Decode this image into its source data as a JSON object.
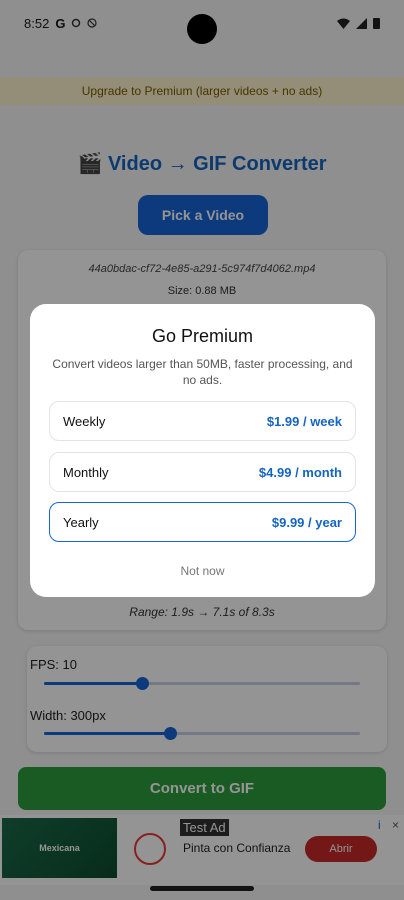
{
  "status": {
    "time": "8:52",
    "g": "G"
  },
  "banner": {
    "text": "Upgrade to Premium (larger videos + no ads)"
  },
  "title": "🎬 Video → GIF Converter",
  "pick_button": "Pick a Video",
  "file": {
    "name": "44a0bdac-cf72-4e85-a291-5c974f7d4062.mp4",
    "size": "Size: 0.88 MB",
    "range": "Range: 1.9s → 7.1s of 8.3s"
  },
  "settings": {
    "fps_label": "FPS: 10",
    "fps_fraction": 0.31,
    "width_label": "Width: 300px",
    "width_fraction": 0.4
  },
  "convert_button": "Convert to GIF",
  "ad": {
    "tag": "Test Ad",
    "title": "Pinta con Confianza",
    "cta": "Abrir",
    "image_text": "Mexicana",
    "info_icon": "i",
    "close_icon": "×"
  },
  "dialog": {
    "title": "Go Premium",
    "description": "Convert videos larger than 50MB, faster processing, and no ads.",
    "plans": [
      {
        "name": "Weekly",
        "price": "$1.99 / week"
      },
      {
        "name": "Monthly",
        "price": "$4.99 / month"
      },
      {
        "name": "Yearly",
        "price": "$9.99 / year"
      }
    ],
    "selected_plan": "Yearly",
    "dismiss": "Not now"
  },
  "colors": {
    "accent": "#1565d8",
    "convert": "#2e9e3f",
    "banner_bg": "#fff3cd"
  }
}
